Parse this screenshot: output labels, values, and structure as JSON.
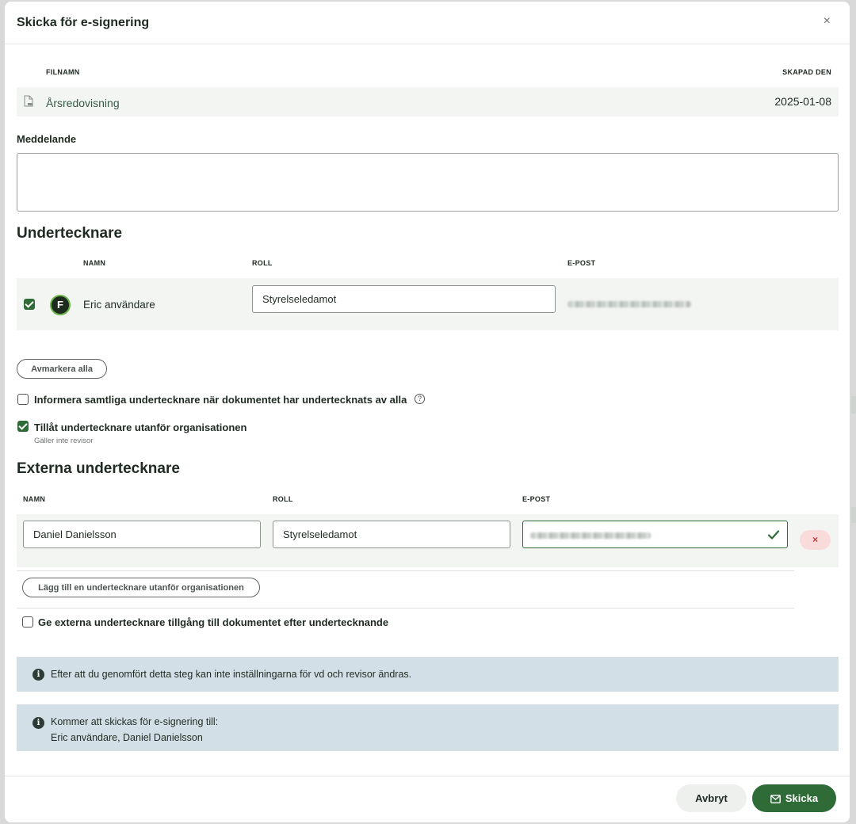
{
  "dialog": {
    "title": "Skicka för e-signering",
    "close_icon": "close-icon",
    "close_glyph": "×"
  },
  "file_table": {
    "col_filename": "FILNAMN",
    "col_created": "SKAPAD DEN",
    "file": {
      "icon": "pdf-file-icon",
      "name": "Årsredovisning",
      "created": "2025-01-08"
    }
  },
  "message": {
    "label": "Meddelande",
    "value": ""
  },
  "signers": {
    "heading": "Undertecknare",
    "col_name": "NAMN",
    "col_role": "ROLL",
    "col_email": "E-POST",
    "rows": [
      {
        "checked": true,
        "avatar_letter": "F",
        "name": "Eric användare",
        "role": "Styrelseledamot",
        "email_blurred": true
      }
    ],
    "deselect_all": "Avmarkera alla"
  },
  "options": {
    "inform_all": {
      "checked": false,
      "label": "Informera samtliga undertecknare när dokumentet har undertecknats av alla",
      "help_glyph": "?"
    },
    "allow_external": {
      "checked": true,
      "label": "Tillåt undertecknare utanför organisationen",
      "hint": "Gäller inte revisor"
    }
  },
  "external": {
    "heading": "Externa undertecknare",
    "col_name": "NAMN",
    "col_role": "ROLL",
    "col_email": "E-POST",
    "rows": [
      {
        "name": "Daniel Danielsson",
        "role": "Styrelseledamot",
        "email_blurred": true,
        "email_valid": true
      }
    ],
    "remove_glyph": "×",
    "add_button": "Lägg till en undertecknare utanför organisationen",
    "give_access": {
      "checked": false,
      "label": "Ge externa undertecknare tillgång till dokumentet efter undertecknande"
    }
  },
  "info_boxes": [
    {
      "icon": "info-icon",
      "glyph": "i",
      "lines": [
        "Efter att du genomfört detta steg kan inte inställningarna för vd och revisor ändras."
      ]
    },
    {
      "icon": "info-icon",
      "glyph": "i",
      "lines": [
        "Kommer att skickas för e-signering till:",
        "Eric användare, Daniel Danielsson"
      ]
    }
  ],
  "footer": {
    "cancel": "Avbryt",
    "send": "Skicka",
    "send_icon": "envelope-icon"
  },
  "colors": {
    "primary": "#2e6b36",
    "info_bg": "#d3dfe6",
    "row_bg": "#f3f5f3",
    "danger_bg": "#fadbdb"
  }
}
